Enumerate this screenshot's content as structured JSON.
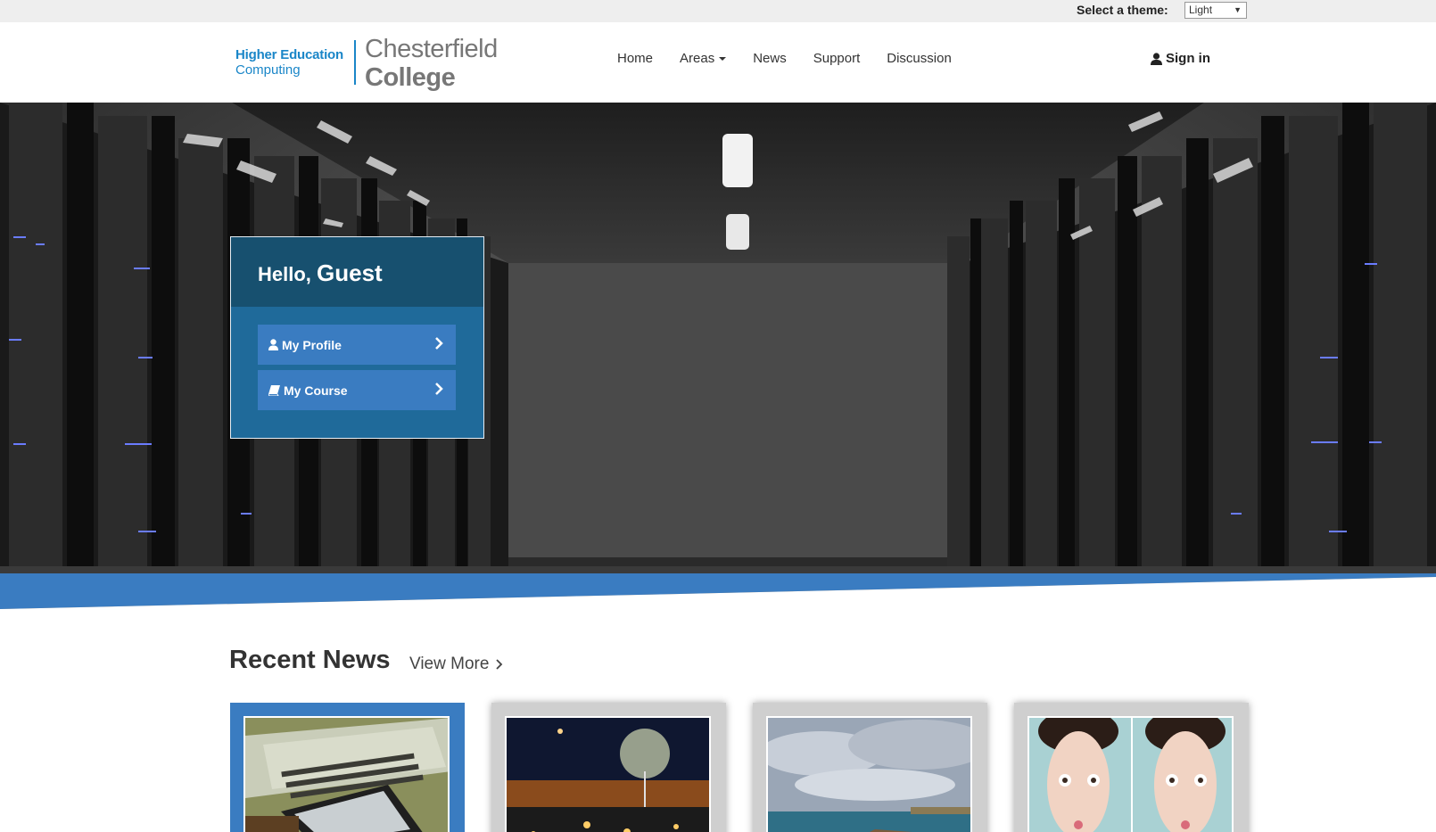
{
  "theme": {
    "label": "Select a theme:",
    "selected": "Light"
  },
  "logo": {
    "line1": "Higher Education",
    "line2": "Computing",
    "college1": "Chesterfield",
    "college2": "College"
  },
  "nav": {
    "items": [
      {
        "label": "Home"
      },
      {
        "label": "Areas"
      },
      {
        "label": "News"
      },
      {
        "label": "Support"
      },
      {
        "label": "Discussion"
      }
    ],
    "signin": "Sign in"
  },
  "welcome": {
    "greeting": "Hello,",
    "name": "Guest",
    "profile_label": "My Profile",
    "course_label": "My Course"
  },
  "news": {
    "title": "Recent News",
    "view_more": "View More"
  },
  "colors": {
    "accent": "#3a7cc1",
    "panel_dark": "#17506f",
    "brand": "#1a86c8"
  }
}
